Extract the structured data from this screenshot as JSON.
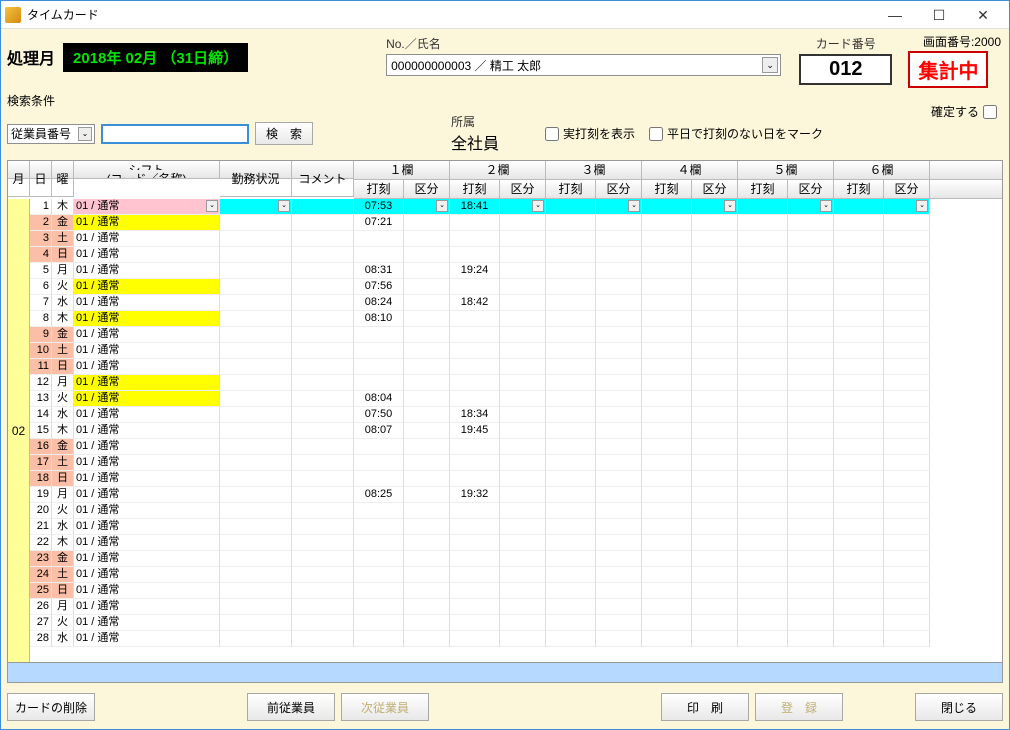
{
  "window": {
    "title": "タイムカード"
  },
  "screen_no": "画面番号:2000",
  "proc": {
    "label": "処理月",
    "badge": "2018年 02月 （31日締）"
  },
  "name": {
    "label": "No.／氏名",
    "value": "000000000003 ／ 精工 太郎"
  },
  "belong": {
    "label": "所属",
    "value": "全社員"
  },
  "card": {
    "label": "カード番号",
    "value": "012"
  },
  "status": "集計中",
  "confirm": {
    "label": "確定する"
  },
  "search": {
    "label": "検索条件",
    "combo": "従業員番号",
    "btn": "検　索"
  },
  "check1": "実打刻を表示",
  "check2": "平日で打刻のない日をマーク",
  "headers": {
    "month": "月",
    "day": "日",
    "weekday": "曜",
    "shift_top": "シフト",
    "shift_bot": "(コード／名称)",
    "work": "勤務状況",
    "comment": "コメント",
    "cols": [
      "１欄",
      "２欄",
      "３欄",
      "４欄",
      "５欄",
      "６欄"
    ],
    "time": "打刻",
    "kubun": "区分"
  },
  "month_label": "02",
  "rows": [
    {
      "d": "1",
      "w": "木",
      "shift": "01 / 通常",
      "rowcls": "",
      "shiftcls": "pink",
      "t1": "07:53",
      "t2": "18:41",
      "active": true
    },
    {
      "d": "2",
      "w": "金",
      "shift": "01 / 通常",
      "rowcls": "weekend",
      "shiftcls": "holiday",
      "t1": "07:21",
      "t2": ""
    },
    {
      "d": "3",
      "w": "土",
      "shift": "01 / 通常",
      "rowcls": "weekend",
      "shiftcls": "",
      "t1": "",
      "t2": ""
    },
    {
      "d": "4",
      "w": "日",
      "shift": "01 / 通常",
      "rowcls": "weekend",
      "shiftcls": "",
      "t1": "",
      "t2": ""
    },
    {
      "d": "5",
      "w": "月",
      "shift": "01 / 通常",
      "rowcls": "",
      "shiftcls": "",
      "t1": "08:31",
      "t2": "19:24"
    },
    {
      "d": "6",
      "w": "火",
      "shift": "01 / 通常",
      "rowcls": "",
      "shiftcls": "holiday",
      "t1": "07:56",
      "t2": ""
    },
    {
      "d": "7",
      "w": "水",
      "shift": "01 / 通常",
      "rowcls": "",
      "shiftcls": "",
      "t1": "08:24",
      "t2": "18:42"
    },
    {
      "d": "8",
      "w": "木",
      "shift": "01 / 通常",
      "rowcls": "",
      "shiftcls": "holiday",
      "t1": "08:10",
      "t2": ""
    },
    {
      "d": "9",
      "w": "金",
      "shift": "01 / 通常",
      "rowcls": "weekend",
      "shiftcls": "",
      "t1": "",
      "t2": ""
    },
    {
      "d": "10",
      "w": "土",
      "shift": "01 / 通常",
      "rowcls": "weekend",
      "shiftcls": "",
      "t1": "",
      "t2": ""
    },
    {
      "d": "11",
      "w": "日",
      "shift": "01 / 通常",
      "rowcls": "weekend",
      "shiftcls": "",
      "t1": "",
      "t2": ""
    },
    {
      "d": "12",
      "w": "月",
      "shift": "01 / 通常",
      "rowcls": "",
      "shiftcls": "holiday",
      "t1": "",
      "t2": ""
    },
    {
      "d": "13",
      "w": "火",
      "shift": "01 / 通常",
      "rowcls": "",
      "shiftcls": "holiday",
      "t1": "08:04",
      "t2": ""
    },
    {
      "d": "14",
      "w": "水",
      "shift": "01 / 通常",
      "rowcls": "",
      "shiftcls": "",
      "t1": "07:50",
      "t2": "18:34"
    },
    {
      "d": "15",
      "w": "木",
      "shift": "01 / 通常",
      "rowcls": "",
      "shiftcls": "",
      "t1": "08:07",
      "t2": "19:45"
    },
    {
      "d": "16",
      "w": "金",
      "shift": "01 / 通常",
      "rowcls": "weekend",
      "shiftcls": "",
      "t1": "",
      "t2": ""
    },
    {
      "d": "17",
      "w": "土",
      "shift": "01 / 通常",
      "rowcls": "weekend",
      "shiftcls": "",
      "t1": "",
      "t2": ""
    },
    {
      "d": "18",
      "w": "日",
      "shift": "01 / 通常",
      "rowcls": "weekend",
      "shiftcls": "",
      "t1": "",
      "t2": ""
    },
    {
      "d": "19",
      "w": "月",
      "shift": "01 / 通常",
      "rowcls": "",
      "shiftcls": "",
      "t1": "08:25",
      "t2": "19:32"
    },
    {
      "d": "20",
      "w": "火",
      "shift": "01 / 通常",
      "rowcls": "",
      "shiftcls": "",
      "t1": "",
      "t2": ""
    },
    {
      "d": "21",
      "w": "水",
      "shift": "01 / 通常",
      "rowcls": "",
      "shiftcls": "",
      "t1": "",
      "t2": ""
    },
    {
      "d": "22",
      "w": "木",
      "shift": "01 / 通常",
      "rowcls": "",
      "shiftcls": "",
      "t1": "",
      "t2": ""
    },
    {
      "d": "23",
      "w": "金",
      "shift": "01 / 通常",
      "rowcls": "weekend",
      "shiftcls": "",
      "t1": "",
      "t2": ""
    },
    {
      "d": "24",
      "w": "土",
      "shift": "01 / 通常",
      "rowcls": "weekend",
      "shiftcls": "",
      "t1": "",
      "t2": ""
    },
    {
      "d": "25",
      "w": "日",
      "shift": "01 / 通常",
      "rowcls": "weekend",
      "shiftcls": "",
      "t1": "",
      "t2": ""
    },
    {
      "d": "26",
      "w": "月",
      "shift": "01 / 通常",
      "rowcls": "",
      "shiftcls": "",
      "t1": "",
      "t2": ""
    },
    {
      "d": "27",
      "w": "火",
      "shift": "01 / 通常",
      "rowcls": "",
      "shiftcls": "",
      "t1": "",
      "t2": ""
    },
    {
      "d": "28",
      "w": "水",
      "shift": "01 / 通常",
      "rowcls": "",
      "shiftcls": "",
      "t1": "",
      "t2": ""
    }
  ],
  "buttons": {
    "delete": "カードの削除",
    "prev": "前従業員",
    "next": "次従業員",
    "print": "印　刷",
    "register": "登　録",
    "close": "閉じる"
  }
}
